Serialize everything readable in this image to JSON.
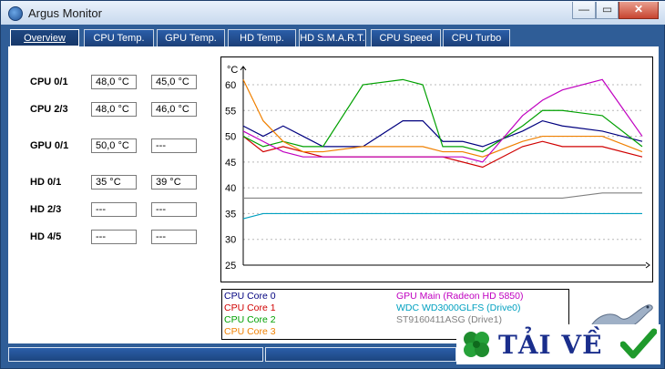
{
  "window": {
    "title": "Argus Monitor",
    "minimize": "—",
    "maximize": "▭",
    "close": "✕"
  },
  "tabs": [
    {
      "label": "Overview",
      "active": true
    },
    {
      "label": "CPU Temp."
    },
    {
      "label": "GPU Temp."
    },
    {
      "label": "HD Temp."
    },
    {
      "label": "HD S.M.A.R.T."
    },
    {
      "label": "CPU Speed"
    },
    {
      "label": "CPU Turbo"
    }
  ],
  "readings": [
    {
      "label": "CPU 0/1",
      "v1": "48,0 °C",
      "v2": "45,0 °C"
    },
    {
      "label": "CPU 2/3",
      "v1": "48,0 °C",
      "v2": "46,0 °C"
    },
    {
      "label": "GPU 0/1",
      "v1": "50,0 °C",
      "v2": "---"
    },
    {
      "label": "HD 0/1",
      "v1": "35 °C",
      "v2": "39 °C"
    },
    {
      "label": "HD 2/3",
      "v1": "---",
      "v2": "---"
    },
    {
      "label": "HD 4/5",
      "v1": "---",
      "v2": "---"
    }
  ],
  "chart_data": {
    "type": "line",
    "ylabel": "°C",
    "ylim": [
      25,
      60
    ],
    "yticks": [
      25,
      30,
      35,
      40,
      45,
      50,
      55,
      60
    ],
    "grid": true,
    "x": [
      0,
      5,
      10,
      15,
      20,
      30,
      40,
      45,
      50,
      55,
      60,
      70,
      75,
      80,
      90,
      100
    ],
    "series": [
      {
        "name": "CPU Core 0",
        "color": "#00007f",
        "values": [
          52,
          50,
          52,
          50,
          48,
          48,
          53,
          53,
          49,
          49,
          48,
          51,
          53,
          52,
          51,
          49
        ]
      },
      {
        "name": "CPU Core 1",
        "color": "#d00000",
        "values": [
          50,
          47,
          48,
          47,
          46,
          46,
          46,
          46,
          46,
          45,
          44,
          48,
          49,
          48,
          48,
          46
        ]
      },
      {
        "name": "CPU Core 2",
        "color": "#00a000",
        "values": [
          50,
          48,
          49,
          48,
          48,
          60,
          61,
          60,
          48,
          48,
          47,
          52,
          55,
          55,
          54,
          48
        ]
      },
      {
        "name": "CPU Core 3",
        "color": "#f08000",
        "values": [
          61,
          53,
          49,
          47,
          47,
          48,
          48,
          48,
          47,
          47,
          46,
          49,
          50,
          50,
          50,
          47
        ]
      },
      {
        "name": "GPU Main (Radeon HD 5850)",
        "color": "#c000c0",
        "values": [
          51,
          49,
          47,
          46,
          46,
          46,
          46,
          46,
          46,
          46,
          45,
          54,
          57,
          59,
          61,
          50
        ]
      },
      {
        "name": "WDC WD3000GLFS (Drive0)",
        "color": "#00a0c0",
        "values": [
          34,
          35,
          35,
          35,
          35,
          35,
          35,
          35,
          35,
          35,
          35,
          35,
          35,
          35,
          35,
          35
        ]
      },
      {
        "name": "ST9160411ASG (Drive1)",
        "color": "#808080",
        "values": [
          38,
          38,
          38,
          38,
          38,
          38,
          38,
          38,
          38,
          38,
          38,
          38,
          38,
          38,
          39,
          39
        ]
      }
    ]
  },
  "branding": {
    "text": "TẢI VỀ"
  }
}
